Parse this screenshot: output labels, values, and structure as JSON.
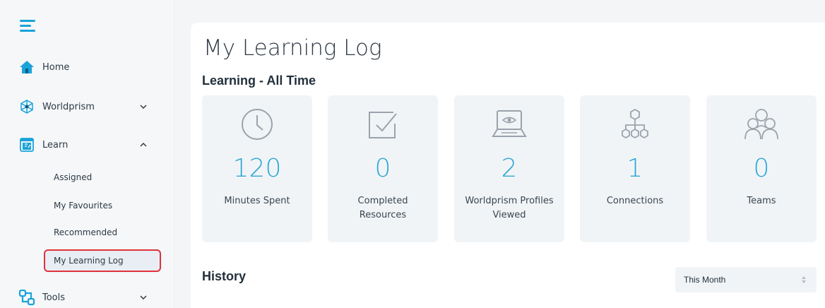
{
  "sidebar": {
    "items": [
      {
        "label": "Home",
        "icon": "home-icon"
      },
      {
        "label": "Worldprism",
        "icon": "worldprism-icon"
      },
      {
        "label": "Learn",
        "icon": "learn-icon"
      },
      {
        "label": "Tools",
        "icon": "tools-icon"
      }
    ],
    "learn_subitems": [
      "Assigned",
      "My Favourites",
      "Recommended",
      "My Learning Log"
    ],
    "active_subitem": "My Learning Log"
  },
  "main": {
    "title": "My Learning Log",
    "section_title": "Learning - All Time",
    "stats": [
      {
        "value": "120",
        "label": "Minutes Spent",
        "icon": "clock-icon"
      },
      {
        "value": "0",
        "label": "Completed Resources",
        "icon": "checkbox-icon"
      },
      {
        "value": "2",
        "label": "Worldprism Profiles Viewed",
        "icon": "laptop-eye-icon"
      },
      {
        "value": "1",
        "label": "Connections",
        "icon": "hierarchy-icon"
      },
      {
        "value": "0",
        "label": "Teams",
        "icon": "team-icon"
      }
    ],
    "history_title": "History",
    "history_filter": {
      "selected": "This Month"
    }
  },
  "colors": {
    "accent": "#2ea8d6",
    "highlight_border": "#e0303c",
    "sidebar_bg": "#f5f7f9",
    "card_bg": "#f1f4f7"
  }
}
